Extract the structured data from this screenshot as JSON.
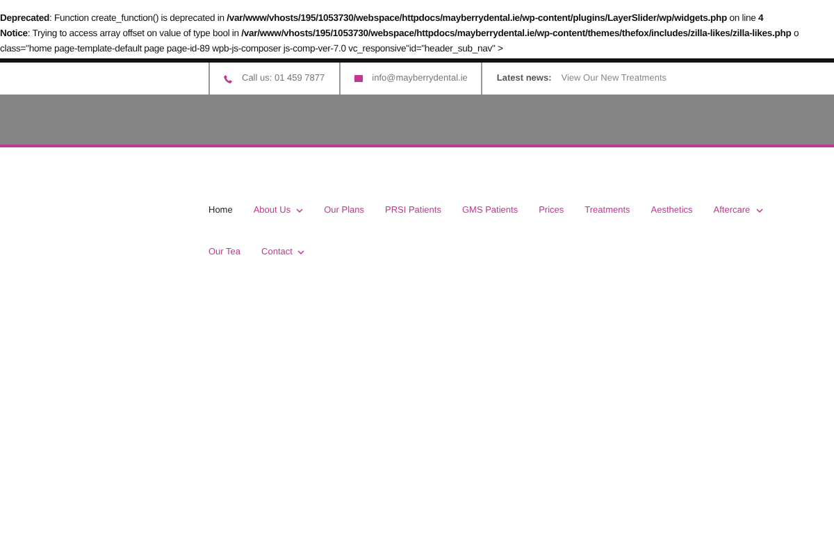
{
  "notices": [
    "**Deprecated**: Function create_function() is deprecated in **/var/www/vhosts/195/1053730/webspace/httpdocs/mayberrydental.ie/wp-content/plugins/LayerSlider/wp/widgets.php** on line **4**",
    "**Notice**: Trying to access array offset on value of type bool in **/var/www/vhosts/195/1053730/webspace/httpdocs/mayberrydental.ie/wp-content/themes/thefox/includes/zilla-likes/zilla-likes.php** o",
    "class=\"home page-template-default page page-id-89 wpb-js-composer js-comp-ver-7.0 vc_responsive\"id=\"header_sub_nav\" >"
  ],
  "top_bar": {
    "phone": "Call us: 01 459 7877",
    "email": "info@mayberrydental.ie",
    "news_label": "Latest news:",
    "news_link": "View Our New Treatments"
  },
  "nav": [
    {
      "label": "Home",
      "selected": true,
      "dropdown": false
    },
    {
      "label": "About Us",
      "selected": false,
      "dropdown": true
    },
    {
      "label": "Our Plans",
      "selected": false,
      "dropdown": false
    },
    {
      "label": "PRSI Patients",
      "selected": false,
      "dropdown": false
    },
    {
      "label": "GMS Patients",
      "selected": false,
      "dropdown": false
    },
    {
      "label": "Prices",
      "selected": false,
      "dropdown": false
    },
    {
      "label": "Treatments",
      "selected": false,
      "dropdown": false
    },
    {
      "label": "Aesthetics",
      "selected": false,
      "dropdown": false
    },
    {
      "label": "Aftercare",
      "selected": false,
      "dropdown": true
    },
    {
      "label": "Our Tea",
      "selected": false,
      "dropdown": false
    },
    {
      "label": "Contact",
      "selected": false,
      "dropdown": true
    }
  ]
}
